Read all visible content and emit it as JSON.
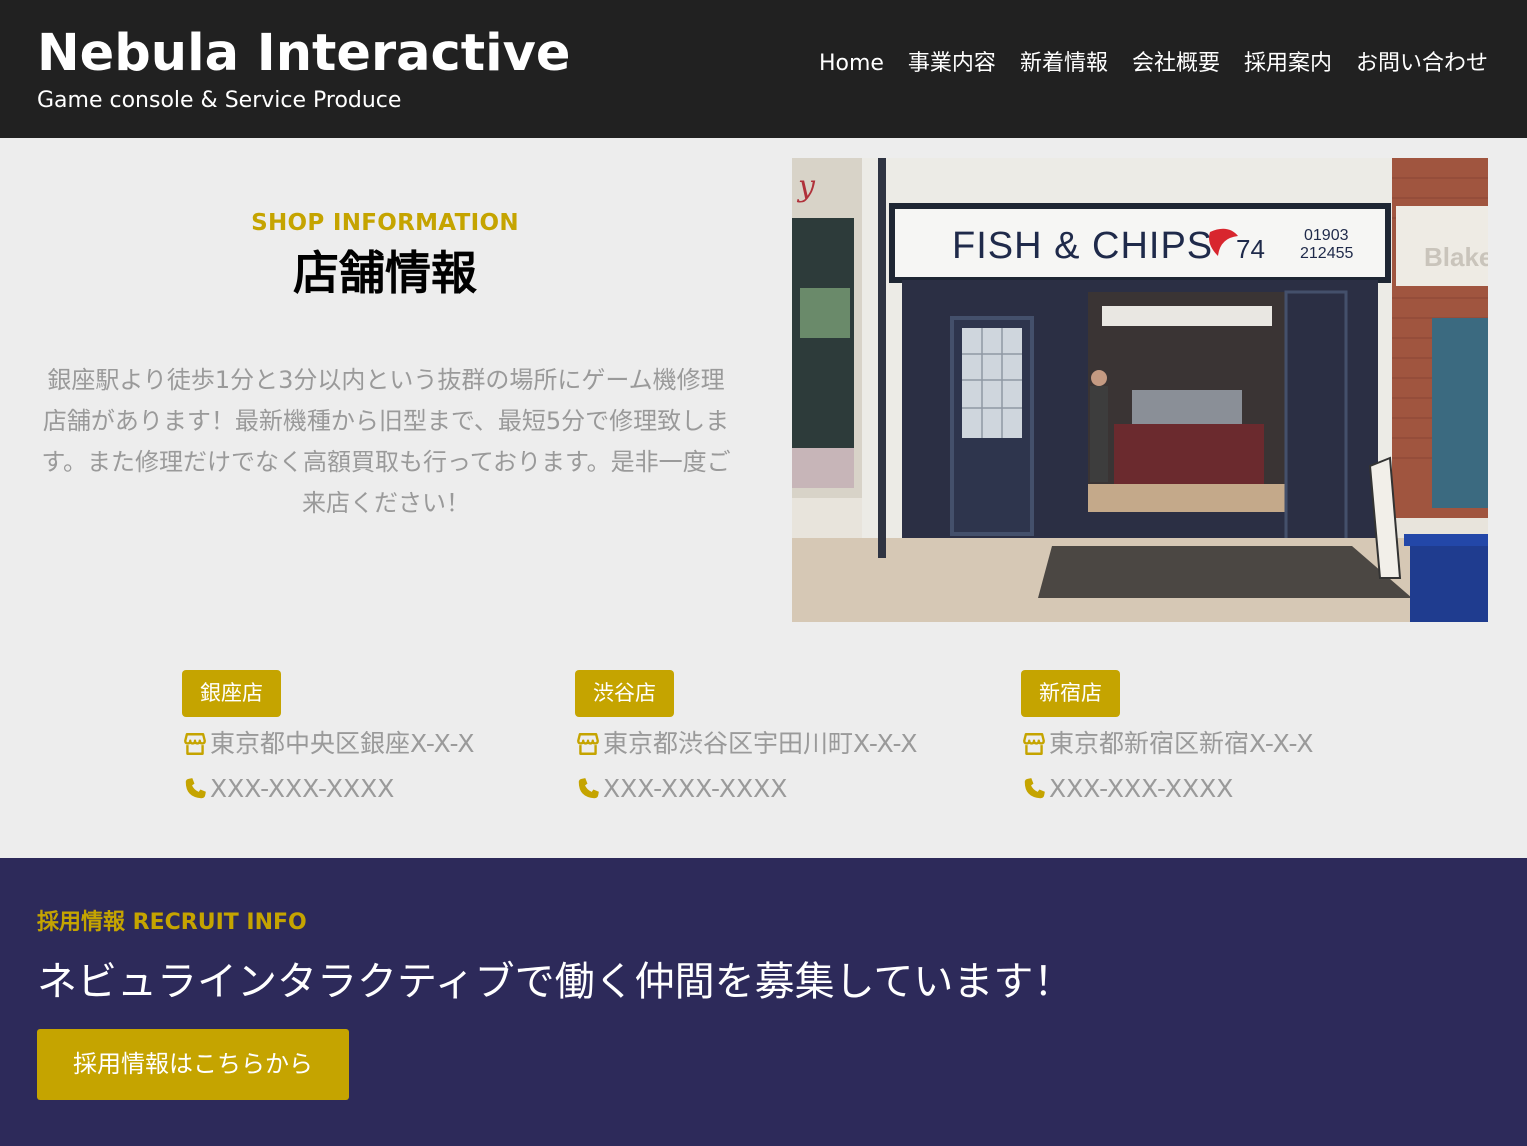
{
  "header": {
    "logo": "Nebula Interactive",
    "tagline": "Game console & Service Produce",
    "nav": [
      "Home",
      "事業内容",
      "新着情報",
      "会社概要",
      "採用案内",
      "お問い合わせ"
    ]
  },
  "shop": {
    "subtitle": "SHOP INFORMATION",
    "title": "店舗情報",
    "description": "銀座駅より徒歩1分と3分以内という抜群の場所にゲーム機修理店舗があります！最新機種から旧型まで、最短5分で修理致します。また修理だけでなく高額買取も行っております。是非一度ご来店ください！",
    "photo": {
      "sign": "FISH & CHIPS",
      "sign_number": "74",
      "phone_1": "01903",
      "phone_2": "212455",
      "side_sign": "Blake"
    },
    "stores": [
      {
        "name": "銀座店",
        "address": "東京都中央区銀座X-X-X",
        "phone": "XXX-XXX-XXXX"
      },
      {
        "name": "渋谷店",
        "address": "東京都渋谷区宇田川町X-X-X",
        "phone": "XXX-XXX-XXXX"
      },
      {
        "name": "新宿店",
        "address": "東京都新宿区新宿X-X-X",
        "phone": "XXX-XXX-XXXX"
      }
    ]
  },
  "recruit": {
    "subtitle": "採用情報 RECRUIT INFO",
    "title": "ネビュラインタラクティブで働く仲間を募集しています！",
    "button": "採用情報はこちらから"
  },
  "icons": {
    "address": "store-icon",
    "phone": "phone-icon"
  },
  "colors": {
    "header_bg": "#212121",
    "accent": "#c5a400",
    "recruit_bg": "#2d2a5a",
    "page_bg": "#ededed",
    "muted_text": "#9a9a9a"
  }
}
